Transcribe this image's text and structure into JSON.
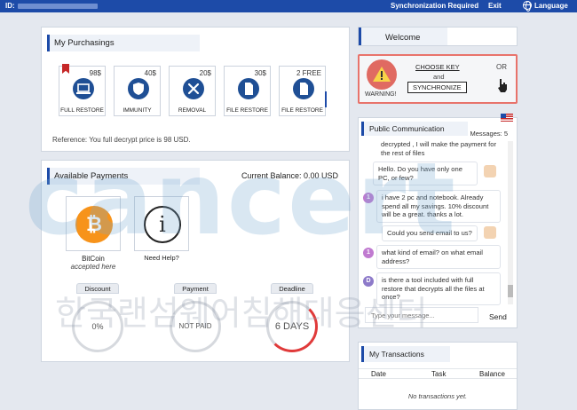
{
  "topbar": {
    "id_label": "ID:",
    "sync": "Synchronization Required",
    "exit": "Exit",
    "language": "Language"
  },
  "watermark": {
    "text": "cancert",
    "korean": "한국랜섬웨어침해대응센터"
  },
  "purchasings": {
    "title": "My Purchasings",
    "products": [
      {
        "price": "98$",
        "label": "FULL RESTORE",
        "icon": "laptop-icon"
      },
      {
        "price": "40$",
        "label": "IMMUNITY",
        "icon": "shield-icon"
      },
      {
        "price": "20$",
        "label": "REMOVAL",
        "icon": "wrench-icon"
      },
      {
        "price": "30$",
        "label": "FILE RESTORE",
        "icon": "file-icon"
      },
      {
        "price": "2 FREE",
        "label": "FILE RESTORE",
        "icon": "file-icon"
      }
    ],
    "reference": "Reference: You full decrypt price is 98 USD."
  },
  "payments": {
    "title": "Available Payments",
    "balance": "Current Balance: 0.00 USD",
    "bitcoin_name": "BitCoin",
    "bitcoin_note": "accepted here",
    "bitcoin_symbol": "₿",
    "help_symbol": "i",
    "help": "Need Help?",
    "discount_label": "Discount",
    "discount_value": "0%",
    "payment_label": "Payment",
    "payment_value": "NOT PAID",
    "deadline_label": "Deadline",
    "deadline_value": "6 DAYS"
  },
  "welcome": {
    "title": "Welcome",
    "choose_key": "CHOOSE  KEY",
    "and": "and",
    "synchronize": "SYNCHRONIZE",
    "or": "OR",
    "warning": "WARNING!"
  },
  "chat": {
    "title": "Public Communication",
    "messages_count": "Messages: 5",
    "msg0": "decrypted , I will make the payment for the rest of files",
    "msg1": "Hello. Do you have only one PC, or few?",
    "msg2": "i have 2 pc and notebook. Already spend all my savings. 10% discount will be a great. thanks a lot.",
    "msg3": "Could you send email to us?",
    "msg4": "what kind of email? on what email address?",
    "msg5": "is there a tool included with full restore that decrypts all the files at once?",
    "avatar_1": "1",
    "avatar_d": "D",
    "placeholder": "Type your message...",
    "send": "Send"
  },
  "transactions": {
    "title": "My Transactions",
    "col_date": "Date",
    "col_task": "Task",
    "col_balance": "Balance",
    "empty": "No transactions yet."
  }
}
